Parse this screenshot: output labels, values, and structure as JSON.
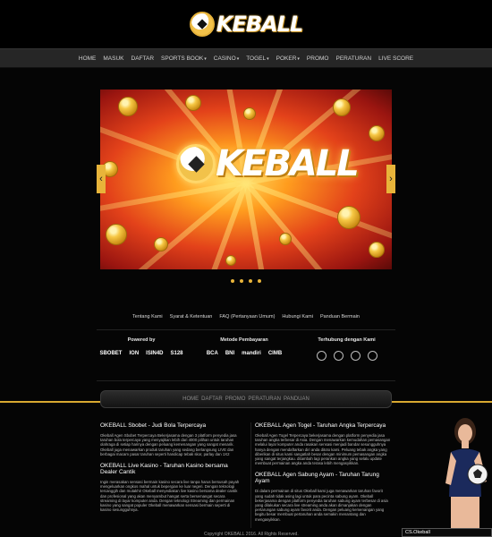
{
  "brand": {
    "name": "KEBALL"
  },
  "nav": {
    "items": [
      {
        "label": "HOME"
      },
      {
        "label": "MASUK"
      },
      {
        "label": "DAFTAR"
      },
      {
        "label": "SPORTS BOOK",
        "caret": "▾"
      },
      {
        "label": "CASINO",
        "caret": "▾"
      },
      {
        "label": "TOGEL",
        "caret": "▾"
      },
      {
        "label": "POKER",
        "caret": "▾"
      },
      {
        "label": "PROMO"
      },
      {
        "label": "PERATURAN"
      },
      {
        "label": "LIVE SCORE"
      }
    ]
  },
  "slider": {
    "brand": "KEBALL",
    "prev_icon": "chevron-left",
    "next_icon": "chevron-right",
    "dots": 4
  },
  "links": {
    "items": [
      {
        "label": "Tentang Kami"
      },
      {
        "label": "Syarat & Ketentuan"
      },
      {
        "label": "FAQ (Pertanyaan Umum)"
      },
      {
        "label": "Hubungi Kami"
      },
      {
        "label": "Panduan Bermain"
      }
    ]
  },
  "partners": {
    "powered": {
      "title": "Powered by",
      "logos": [
        "SBOBET",
        "ION",
        "ISIN4D",
        "S128"
      ]
    },
    "payment": {
      "title": "Metode Pembayaran",
      "logos": [
        "BCA",
        "BNI",
        "mandiri",
        "CIMB"
      ]
    },
    "trusted": {
      "title": "Terhubung dengan Kami"
    }
  },
  "bottom_nav": {
    "items": [
      {
        "label": "HOME"
      },
      {
        "label": "DAFTAR"
      },
      {
        "label": "PROMO"
      },
      {
        "label": "PERATURAN"
      },
      {
        "label": "PANDUAN"
      }
    ]
  },
  "content": {
    "s1": {
      "title": "OKEBALL Sbobet - Judi Bola Terpercaya",
      "body": "Okeball Agen Sbobet Terpercaya Bekerjasama dengan 3 platform penyedia jasa taruhan bola terpercaya yang menyajikan lebih dari 4000 pilihan untuk taruhan olahraga di setiap harinya dengan peluang kemenangan yang sangat menarik. Okeball juga menawarkan produk taruhan yang sedang berlangsung LIVE dan berbagai macam pasar taruhan seperti handicap tebak skor, parlay dan 1X2"
    },
    "s2": {
      "title": "OKEBALL Live Kasino - Taruhan Kasino bersama Dealer Cantik",
      "body": "Ingin merasakan sensasi bermain kasino secara live tanpa harus bersusah payah mengeluarkan ongkos mahal untuk bepergian ke luar negeri. Dengan teknologi tercanggih dan mutakhir Okeball menyediakan live kasino bersama dealer cantik dan profesional yang akan menyambut hangat serta bersemangat secara streaming di layar komputer anda. Dengan teknologi Streaming dan permainan kasino yang sangat populer Okeball menawarkan sensasi bermain seperti di kasino sesungguhnya."
    },
    "s3": {
      "title": "OKEBALL Agen Togel - Taruhan Angka Terpercaya",
      "body": "Okeball Agen Togel Terpercaya bekerjasama dengan platform penyedia jasa taruhan angka terbesar di Asia. Dengan menawarkan kemudahan pemasangan melalui layar komputer anda rasakan sensasi menjadi bandar sesungguhnya hanya dengan mendaftarkan diri anda ditoto kami. Peluang tebak angka yang diberikan di situs kami sangatlah besar dengan minimum pemasangan angka yang sangat terjangkau. ditambah lagi perankan angka yang selalu update membuat permainan angka anda terasa lebih mengasyikkan."
    },
    "s4": {
      "title": "OKEBALL Agen Sabung Ayam - Taruhan Tarung Ayam",
      "body": "Di dalam permainan di situs Okeball kami juga menawarkan taruhan favorit yang sudah tidak asing lagi untuk para pecinta sabung ayam. Okeball bekerjasama dengan platform penyedia taruhan sabung ayam terbesar di asia yang dilakukan secara live streaming anda akan dimanjakan dengan pertarungan sabung ayam favorit anda. Dengan peluang kemenangan yang begitu besar membuat pertaruhan anda semakin menantang dan mengasyikkan."
    }
  },
  "footer": {
    "copyright": "Copyright OKEBALL 2016. All Rights Reserved."
  },
  "cs": {
    "label": "CS.Okeball"
  }
}
